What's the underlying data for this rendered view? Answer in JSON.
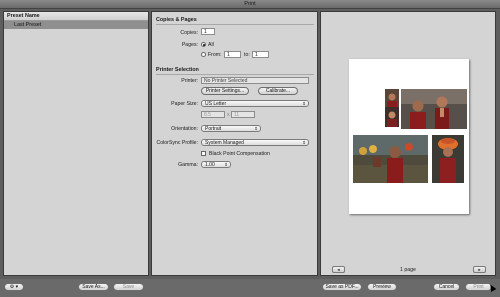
{
  "window": {
    "title": "Print"
  },
  "presets": {
    "header": "Preset Name",
    "items": [
      "Last Preset"
    ]
  },
  "copies_pages": {
    "section_title": "Copies & Pages",
    "copies_label": "Copies:",
    "copies_value": "1",
    "pages_label": "Pages:",
    "all_label": "All",
    "from_label": "From:",
    "from_value": "1",
    "to_label": "to:",
    "to_value": "1"
  },
  "printer_selection": {
    "section_title": "Printer Selection",
    "printer_label": "Printer:",
    "printer_value": "No Printer Selected",
    "printer_settings_button": "Printer Settings...",
    "calibrate_button": "Calibrate...",
    "paper_size_label": "Paper Size:",
    "paper_size_value": "US Letter",
    "paper_width": "8.5",
    "paper_height": "11",
    "by_symbol": "x",
    "orientation_label": "Orientation:",
    "orientation_value": "Portrait",
    "colorsync_label": "ColorSync Profile:",
    "colorsync_value": "System Managed",
    "black_point_label": "Black Point Compensation",
    "gamma_label": "Gamma:",
    "gamma_value": "1.00"
  },
  "preview": {
    "page_count": "1 page",
    "prev_icon": "arrow-left-icon",
    "next_icon": "arrow-right-icon"
  },
  "footer": {
    "gear_icon": "gear-icon",
    "save_as_button": "Save As...",
    "save_button": "Save",
    "save_pdf_button": "Save as PDF...",
    "preview_button": "Preview",
    "cancel_button": "Cancel",
    "print_button": "Print"
  }
}
